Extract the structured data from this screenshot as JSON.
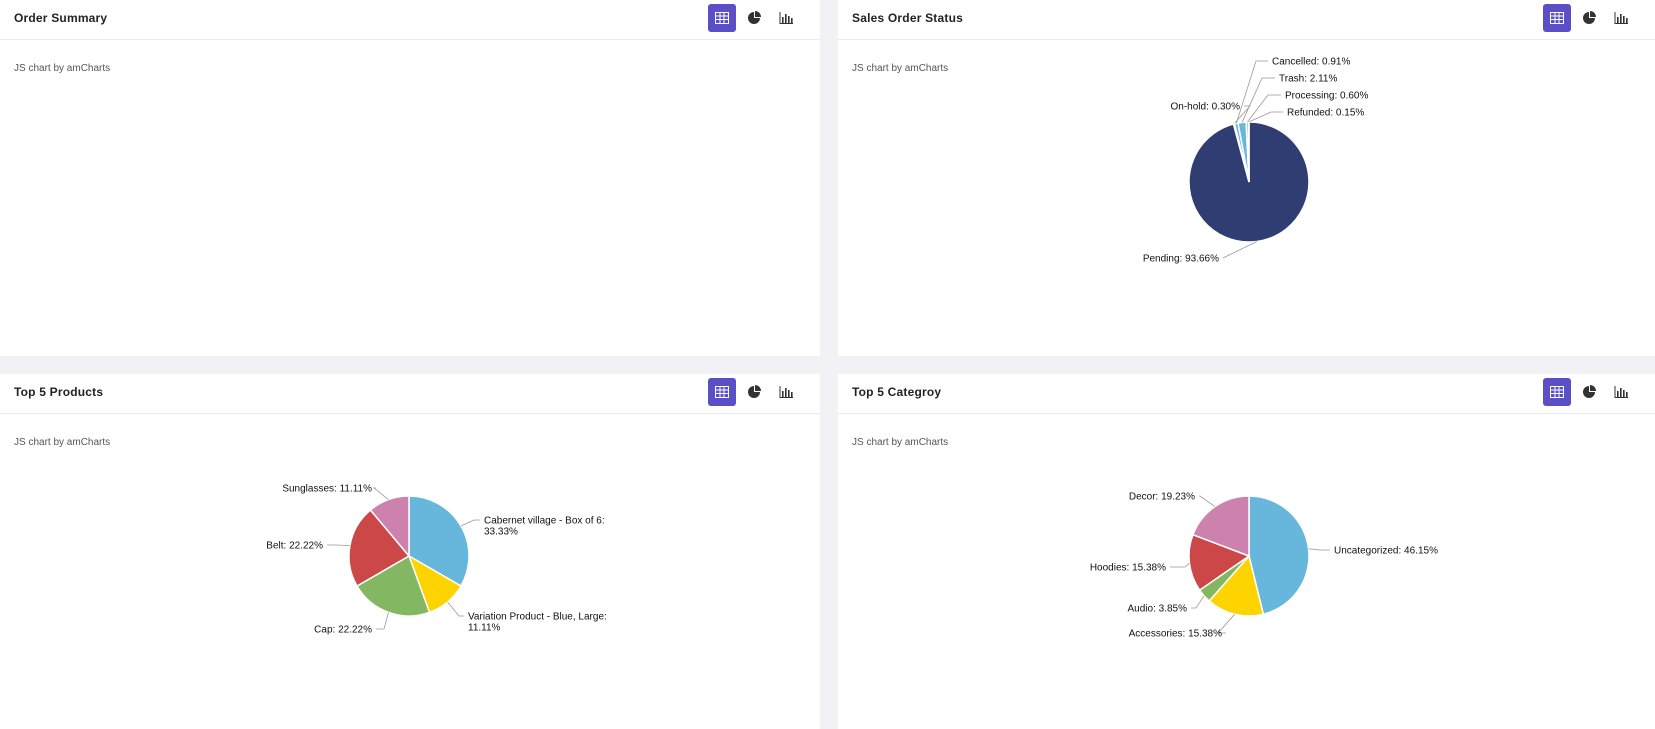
{
  "panels": [
    {
      "id": "order_summary",
      "title": "Order Summary",
      "credit": "JS chart by amCharts"
    },
    {
      "id": "sales_order_status",
      "title": "Sales Order Status",
      "credit": "JS chart by amCharts"
    },
    {
      "id": "top_products",
      "title": "Top 5 Products",
      "credit": "JS chart by amCharts"
    },
    {
      "id": "top_category",
      "title": "Top 5 Categroy",
      "credit": "JS chart by amCharts"
    }
  ],
  "view_buttons": [
    "table-view-icon",
    "pie-chart-icon",
    "bar-chart-icon"
  ],
  "colors": {
    "accent": "#5b4fc7",
    "pending": "#2f3d72",
    "blue": "#67b7dc",
    "green": "#84b761",
    "yellow": "#fdd400",
    "red": "#cc4748",
    "pink": "#cd82ad"
  },
  "chart_data": [
    {
      "type": "pie",
      "panel": "sales_order_status",
      "slices": [
        {
          "label": "Pending",
          "value": 93.66,
          "display": "Pending: 93.66%",
          "color": "#2f3d72"
        },
        {
          "label": "On-hold",
          "value": 0.3,
          "display": "On-hold: 0.30%",
          "color": "#67b7dc"
        },
        {
          "label": "Cancelled",
          "value": 0.91,
          "display": "Cancelled: 0.91%",
          "color": "#67b7dc"
        },
        {
          "label": "Trash",
          "value": 2.11,
          "display": "Trash: 2.11%",
          "color": "#67b7dc"
        },
        {
          "label": "Processing",
          "value": 0.6,
          "display": "Processing: 0.60%",
          "color": "#84b761"
        },
        {
          "label": "Refunded",
          "value": 0.15,
          "display": "Refunded: 0.15%",
          "color": "#84b761"
        }
      ]
    },
    {
      "type": "pie",
      "panel": "top_products",
      "slices": [
        {
          "label": "Cabernet village - Box of 6:",
          "value": 33.33,
          "display": [
            "Cabernet village - Box of 6:",
            "33.33%"
          ],
          "color": "#67b7dc"
        },
        {
          "label": "Variation Product - Blue, Large:",
          "value": 11.11,
          "display": [
            "Variation Product - Blue, Large:",
            "11.11%"
          ],
          "color": "#fdd400"
        },
        {
          "label": "Cap",
          "value": 22.22,
          "display": "Cap: 22.22%",
          "color": "#84b761"
        },
        {
          "label": "Belt",
          "value": 22.22,
          "display": "Belt: 22.22%",
          "color": "#cc4748"
        },
        {
          "label": "Sunglasses",
          "value": 11.11,
          "display": "Sunglasses: 11.11%",
          "color": "#cd82ad"
        }
      ]
    },
    {
      "type": "pie",
      "panel": "top_category",
      "slices": [
        {
          "label": "Uncategorized",
          "value": 46.15,
          "display": "Uncategorized: 46.15%",
          "color": "#67b7dc"
        },
        {
          "label": "Accessories",
          "value": 15.38,
          "display": "Accessories: 15.38%",
          "color": "#fdd400"
        },
        {
          "label": "Audio",
          "value": 3.85,
          "display": "Audio: 3.85%",
          "color": "#84b761"
        },
        {
          "label": "Hoodies",
          "value": 15.38,
          "display": "Hoodies: 15.38%",
          "color": "#cc4748"
        },
        {
          "label": "Decor",
          "value": 19.23,
          "display": "Decor: 19.23%",
          "color": "#cd82ad"
        }
      ]
    }
  ]
}
